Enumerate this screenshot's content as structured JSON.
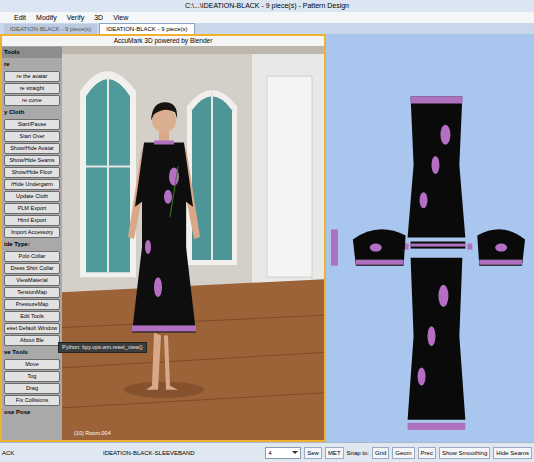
{
  "window": {
    "title": "C:\\...\\IDEATION-BLACK - 9 piece(s) - Pattern Design"
  },
  "menu": [
    "Edit",
    "Modify",
    "Verify",
    "3D",
    "View"
  ],
  "tabs": [
    {
      "label": "IDEATION-BLACK - 9 piece(s)",
      "selected": false
    },
    {
      "label": "IDEATION-BLACK - 9 piece(s)",
      "selected": true
    }
  ],
  "viewer": {
    "title": "AccuMark 3D powered by Blender",
    "label": "(10) Room.004",
    "tooltip": "Python: bpy.ops.wm.reset_view()"
  },
  "tools": [
    {
      "label": "Tools",
      "kind": "header"
    },
    {
      "label": "re",
      "kind": "section"
    },
    {
      "label": "re the avatar",
      "kind": "button"
    },
    {
      "label": "re straight",
      "kind": "button"
    },
    {
      "label": "re curve",
      "kind": "button"
    },
    {
      "label": "y Cloth",
      "kind": "section"
    },
    {
      "label": "Start/Pause",
      "kind": "button"
    },
    {
      "label": "Start Over",
      "kind": "button"
    },
    {
      "label": "Show/Hide Avatar",
      "kind": "button"
    },
    {
      "label": "Show/Hide Seams",
      "kind": "button"
    },
    {
      "label": "Show/Hide Floor",
      "kind": "button"
    },
    {
      "label": "/Hide Undergarm",
      "kind": "button"
    },
    {
      "label": "Update Cloth",
      "kind": "button"
    },
    {
      "label": "PLM Export",
      "kind": "button"
    },
    {
      "label": "Html Export",
      "kind": "button"
    },
    {
      "label": "Import Accessory",
      "kind": "button"
    },
    {
      "label": "ide Type:",
      "kind": "section"
    },
    {
      "label": "Polo Collar",
      "kind": "button"
    },
    {
      "label": "Dress Shirt Collar",
      "kind": "button"
    },
    {
      "label": "ViewMaterial",
      "kind": "button"
    },
    {
      "label": "TensionMap",
      "kind": "button"
    },
    {
      "label": "PressureMap",
      "kind": "button"
    },
    {
      "label": "Edit Tools",
      "kind": "button"
    },
    {
      "label": "eset Default Window",
      "kind": "button"
    },
    {
      "label": "About Ble",
      "kind": "button"
    },
    {
      "label": "ve Tools",
      "kind": "section"
    },
    {
      "label": "Move",
      "kind": "button"
    },
    {
      "label": "Tog",
      "kind": "button"
    },
    {
      "label": "Drag",
      "kind": "button"
    },
    {
      "label": "Fix Collisions",
      "kind": "button"
    },
    {
      "label": "ose Pose",
      "kind": "section"
    }
  ],
  "status_bar": {
    "left": "ACK",
    "piece": "IDEATION-BLACK-SLEEVEBAND",
    "dropdown": "4",
    "items": [
      {
        "label": "Sew",
        "kind": "button"
      },
      {
        "label": "MET",
        "kind": "button"
      },
      {
        "label": "Snap to:",
        "kind": "label"
      },
      {
        "label": "Grid",
        "kind": "button"
      },
      {
        "label": "Geom",
        "kind": "button"
      },
      {
        "label": "Prec",
        "kind": "button"
      },
      {
        "label": "Show Smoothing",
        "kind": "button"
      },
      {
        "label": "Hide Seams",
        "kind": "button"
      }
    ]
  }
}
